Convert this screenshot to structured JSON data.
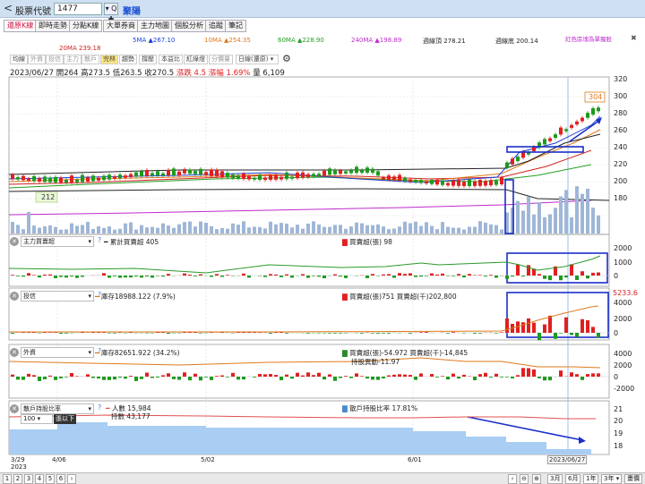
{
  "topbar": {
    "back": "<",
    "label": "股票代號",
    "code": "1477",
    "search": "▾ Q ✚",
    "name": "聚陽"
  },
  "tabs": [
    "還原K線",
    "即時走勢",
    "分點K線",
    "大單券商",
    "主力地圖",
    "個股分析",
    "追蹤",
    "筆記"
  ],
  "ma_legend": [
    {
      "text": "5MA ▲267.10",
      "color": "#1c3fd8"
    },
    {
      "text": "10MA ▲254.35",
      "color": "#e07a1a"
    },
    {
      "text": "60MA ▲228.90",
      "color": "#22a022"
    },
    {
      "text": "240MA ▲198.89",
      "color": "#c02ad0"
    },
    {
      "text": "週線頂 278.21",
      "color": "#222222"
    },
    {
      "text": "週線底 200.14",
      "color": "#222222"
    },
    {
      "text": "20MA 239.18",
      "color": "#d02020"
    }
  ],
  "note_link": "紅色區塊為單獨股",
  "tools": [
    "均線",
    "外資",
    "投信",
    "主力",
    "散戶",
    "完林",
    "趨勢",
    "撐壓",
    "本益比",
    "紅綠燈",
    "分價量",
    "日線(還原)"
  ],
  "ohlc": {
    "date": "2023/06/27",
    "open_label": "開",
    "open": "264",
    "high_label": "高",
    "high": "273.5",
    "low_label": "低",
    "low": "263.5",
    "close_label": "收",
    "close": "270.5",
    "change": "漲跌 4.5",
    "pct": "漲幅 1.69%",
    "vol": "量 6,109"
  },
  "price_axis": [
    "320",
    "300",
    "280",
    "260",
    "240",
    "220",
    "200",
    "180"
  ],
  "high_mark": "304",
  "low_mark": "212",
  "panels": [
    {
      "select": "主力買賣超",
      "line_legend": "累計買賣超 405",
      "bar_legend": "買賣超(張) 98",
      "axis": [
        "2000",
        "1000",
        "0"
      ]
    },
    {
      "select": "投信",
      "line_legend": "庫存18988.122 (7.9%)",
      "bar_legend": "買賣超(張)751 買賣超(千)202,800",
      "axis": [
        "4000",
        "2000",
        "0"
      ],
      "right_mark": "5233.6"
    },
    {
      "select": "外資",
      "line_legend": "庫存82651.922 (34.2%)",
      "bar_legend": "買賣超(張)-54.972 買賣超(千)-14,845",
      "bar_legend2": "持股異動-11.97",
      "axis": [
        "4000",
        "2000",
        "0",
        "-2000"
      ]
    },
    {
      "select": "散戶持股比率",
      "line_legend": "人數 15,984",
      "line_legend2": "持數 43,177",
      "bar_legend": "散戶持股比率 17.81%",
      "axis": [
        "21",
        "20",
        "19",
        "18"
      ],
      "sub_select": "100",
      "sub_label": "張以下"
    }
  ],
  "x_axis": [
    {
      "label": "3/29\n2023"
    },
    {
      "label": "4/06"
    },
    {
      "label": "5/02"
    },
    {
      "label": "6/01"
    }
  ],
  "cursor_date": "2023/06/27",
  "pages": [
    "1",
    "2",
    "3",
    "4",
    "5",
    "6"
  ],
  "zoom": [
    "3月",
    "6月",
    "1年",
    "3年",
    "畫價"
  ]
}
